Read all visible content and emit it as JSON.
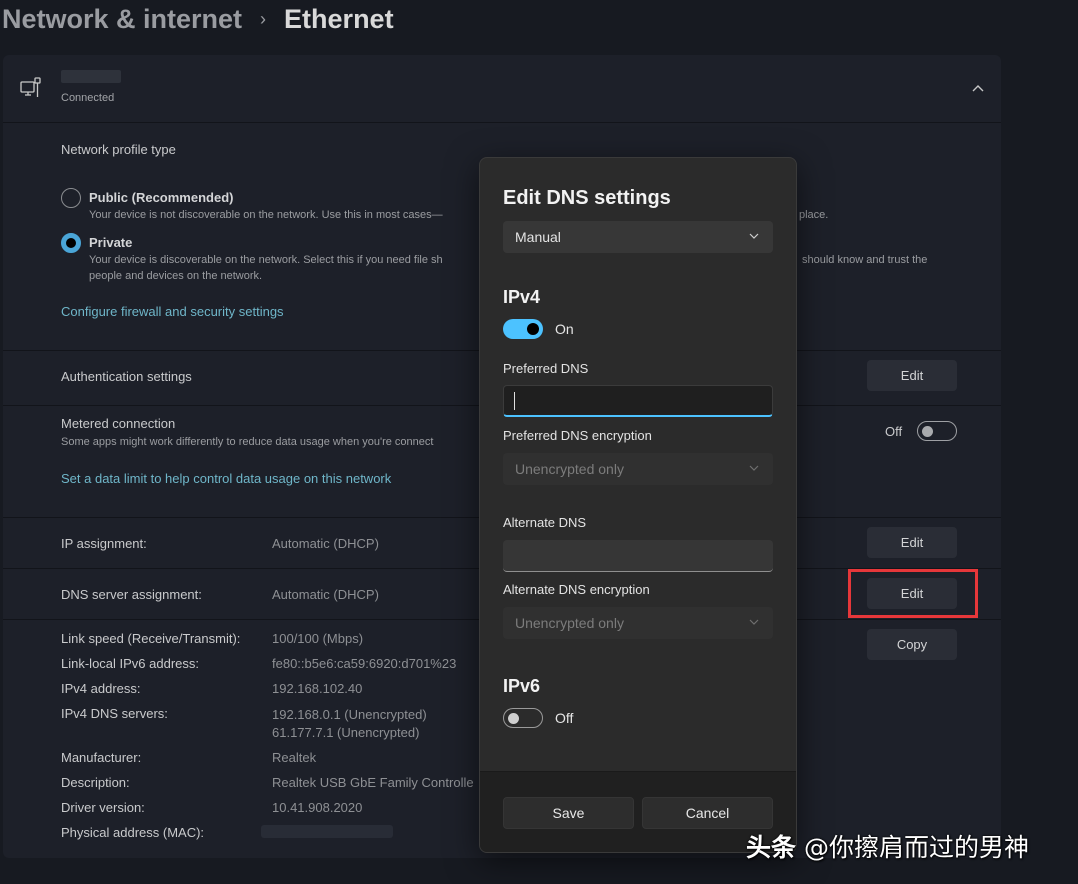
{
  "breadcrumb": {
    "parent": "Network & internet",
    "separator": "›",
    "current": "Ethernet"
  },
  "connection": {
    "name": "",
    "status": "Connected",
    "icon": "ethernet-monitor-icon",
    "expanded": true
  },
  "profile": {
    "heading": "Network profile type",
    "options": [
      {
        "title": "Public (Recommended)",
        "description": "Your device is not discoverable on the network. Use this in most cases—",
        "description_tail": "place.",
        "selected": false
      },
      {
        "title": "Private",
        "description": "Your device is discoverable on the network. Select this if you need file sh",
        "description_tail": "should know and trust the",
        "description_line2": "people and devices on the network.",
        "selected": true
      }
    ],
    "firewall_link": "Configure firewall and security settings"
  },
  "authentication": {
    "label": "Authentication settings",
    "button": "Edit"
  },
  "metered": {
    "label": "Metered connection",
    "description": "Some apps might work differently to reduce data usage when you're connect",
    "toggle_label": "Off",
    "toggle_on": false,
    "data_limit_link": "Set a data limit to help control data usage on this network"
  },
  "ip_assignment": {
    "label": "IP assignment:",
    "value": "Automatic (DHCP)",
    "button": "Edit"
  },
  "dns_assignment": {
    "label": "DNS server assignment:",
    "value": "Automatic (DHCP)",
    "button": "Edit",
    "highlighted": true,
    "highlight_color": "#e6373a"
  },
  "properties": {
    "copy_button": "Copy",
    "items": [
      {
        "label": "Link speed (Receive/Transmit):",
        "value": "100/100 (Mbps)"
      },
      {
        "label": "Link-local IPv6 address:",
        "value": "fe80::b5e6:ca59:6920:d701%23"
      },
      {
        "label": "IPv4 address:",
        "value": "192.168.102.40"
      },
      {
        "label": "IPv4 DNS servers:",
        "value": "192.168.0.1 (Unencrypted)",
        "value2": "61.177.7.1 (Unencrypted)"
      },
      {
        "label": "Manufacturer:",
        "value": "Realtek"
      },
      {
        "label": "Description:",
        "value": "Realtek USB GbE Family Controlle"
      },
      {
        "label": "Driver version:",
        "value": "10.41.908.2020"
      },
      {
        "label": "Physical address (MAC):",
        "value": ""
      }
    ]
  },
  "dialog": {
    "title": "Edit DNS settings",
    "mode_select": "Manual",
    "ipv4": {
      "heading": "IPv4",
      "toggle_label": "On",
      "toggle_on": true,
      "preferred_label": "Preferred DNS",
      "preferred_value": "",
      "preferred_enc_label": "Preferred DNS encryption",
      "preferred_enc_value": "Unencrypted only",
      "alternate_label": "Alternate DNS",
      "alternate_value": "",
      "alternate_enc_label": "Alternate DNS encryption",
      "alternate_enc_value": "Unencrypted only"
    },
    "ipv6": {
      "heading": "IPv6",
      "toggle_label": "Off",
      "toggle_on": false
    },
    "save": "Save",
    "cancel": "Cancel",
    "accent": "#4cc2ff"
  },
  "watermark": {
    "brand": "头条",
    "handle": "@你擦肩而过的男神"
  }
}
